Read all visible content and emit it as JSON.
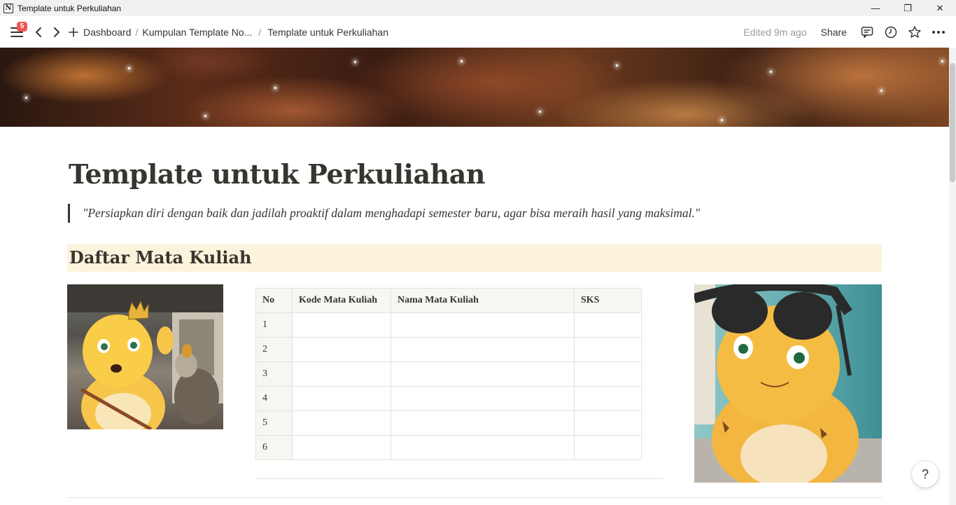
{
  "window": {
    "title": "Template untuk Perkuliahan",
    "controls": {
      "minimize": "—",
      "restore": "❐",
      "close": "✕"
    }
  },
  "topbar": {
    "notification_count": "5",
    "breadcrumb": [
      "Dashboard",
      "Kumpulan Template No...",
      "Template untuk Perkuliahan"
    ],
    "separators": [
      "/",
      "/"
    ],
    "edited": "Edited 9m ago",
    "share_label": "Share",
    "icons": [
      "menu-icon",
      "back-arrow-icon",
      "forward-arrow-icon",
      "plus-icon",
      "comment-icon",
      "clock-icon",
      "star-icon",
      "more-icon"
    ]
  },
  "page": {
    "title": "Template untuk Perkuliahan",
    "quote": "\"Persiapkan diri dengan baik dan jadilah proaktif dalam menghadapi semester baru, agar bisa meraih hasil yang maksimal.\"",
    "heading": "Daftar Mata Kuliah",
    "heading_background": "#fbf3db"
  },
  "table": {
    "columns": [
      "No",
      "Kode Mata Kuliah",
      "Nama Mata Kuliah",
      "SKS"
    ],
    "rows": [
      [
        "1",
        "",
        "",
        ""
      ],
      [
        "2",
        "",
        "",
        ""
      ],
      [
        "3",
        "",
        "",
        ""
      ],
      [
        "4",
        "",
        "",
        ""
      ],
      [
        "5",
        "",
        "",
        ""
      ],
      [
        "6",
        "",
        "",
        ""
      ]
    ]
  },
  "help_label": "?",
  "colors": {
    "text": "#37352f",
    "muted": "#9b9a97",
    "badge": "#eb5757",
    "table_header_bg": "#f7f6f3"
  }
}
